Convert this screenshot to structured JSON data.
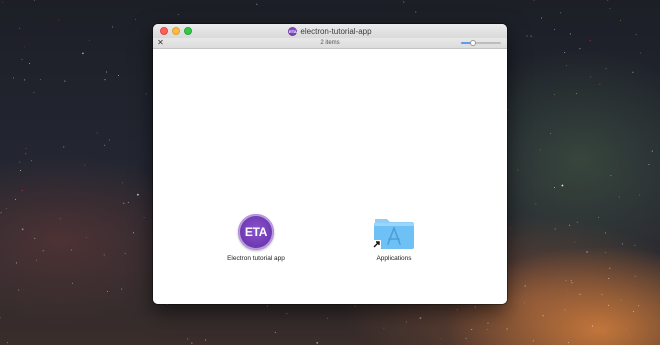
{
  "window": {
    "title": "electron-tutorial-app",
    "title_icon_text": "ETA",
    "status_text": "2 items",
    "icon_size_level": 0.3
  },
  "items": [
    {
      "label": "Electron tutorial app",
      "icon_text": "ETA",
      "icon": "electron-tutorial-app-icon"
    },
    {
      "label": "Applications",
      "icon": "applications-folder-icon",
      "alias": true
    }
  ],
  "colors": {
    "app_purple": "#6a35ad",
    "folder_blue": "#6ec1f5",
    "traffic_red": "#fc605c",
    "traffic_yellow": "#fdbc40",
    "traffic_green": "#34c84a"
  }
}
